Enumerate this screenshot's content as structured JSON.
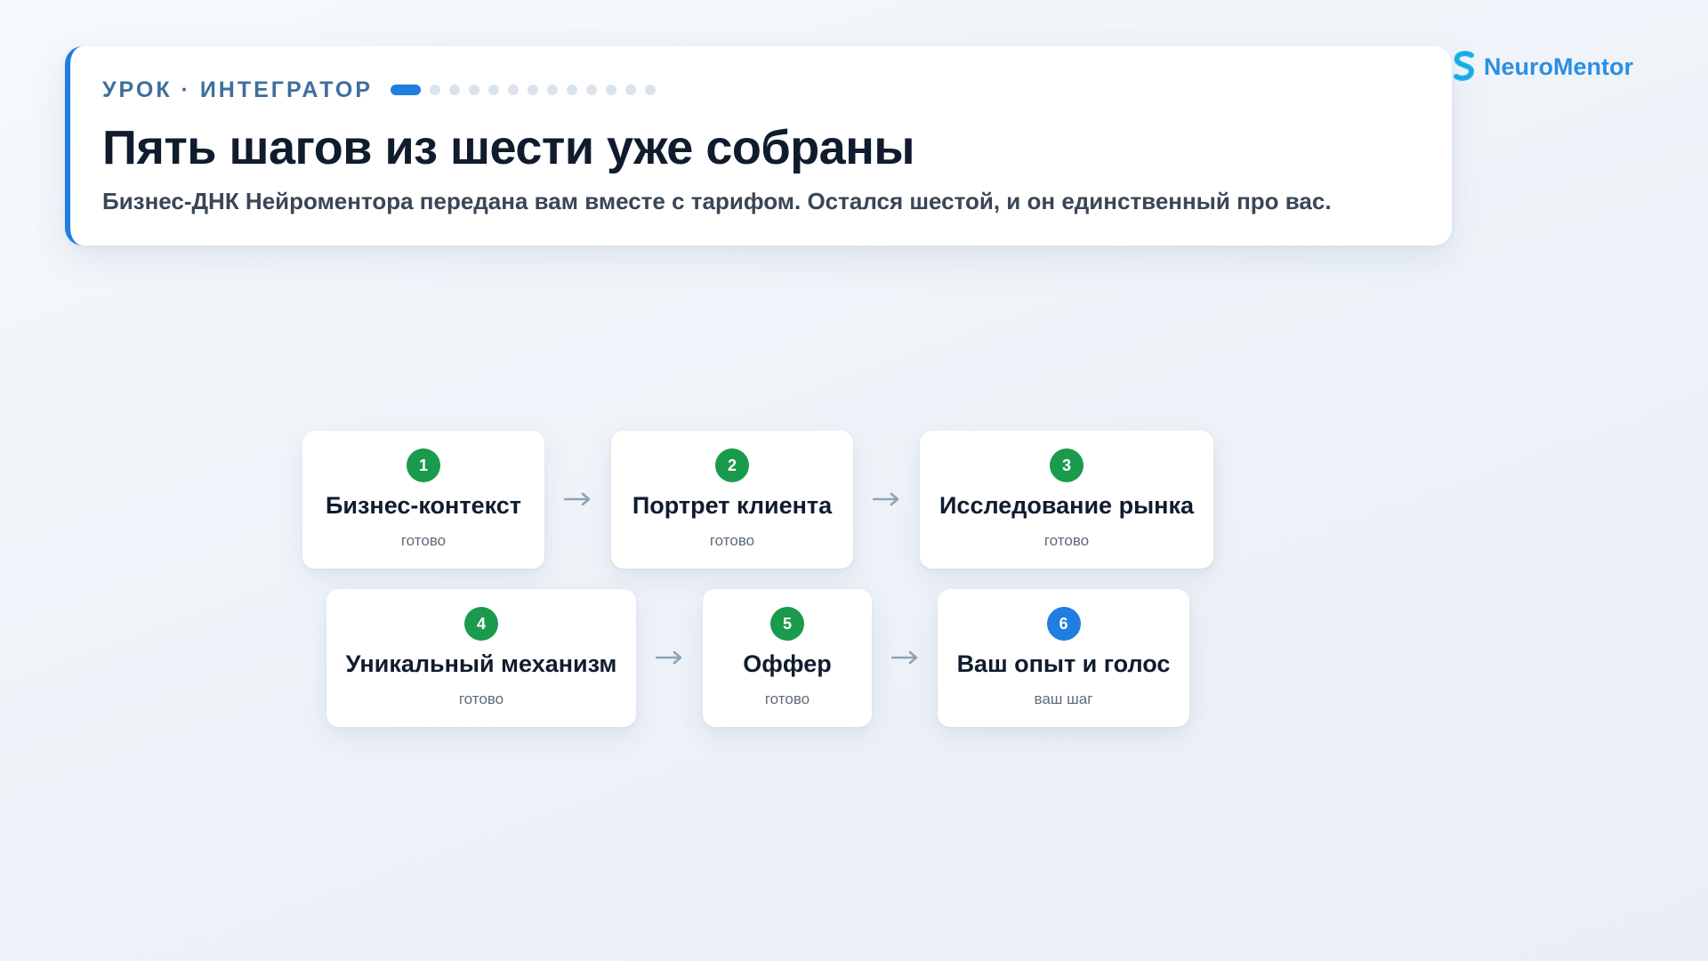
{
  "header": {
    "eyebrow": "УРОК · ИНТЕГРАТОР",
    "progress": {
      "current": 1,
      "total": 13
    },
    "title": "Пять шагов из шести уже собраны",
    "subtitle": "Бизнес-ДНК Нейроментора передана вам вместе с тарифом. Остался шестой, и он единственный про вас."
  },
  "logo": {
    "text": "NeuroMentor",
    "icon": "neuromentor-logo-icon"
  },
  "colors": {
    "accent": "#1f7ee0",
    "done": "#1a9a4c",
    "current": "#1f7ee0",
    "logo": "#2b8fe2"
  },
  "steps": [
    {
      "number": "1",
      "title": "Бизнес-контекст",
      "status": "готово",
      "state": "done"
    },
    {
      "number": "2",
      "title": "Портрет клиента",
      "status": "готово",
      "state": "done"
    },
    {
      "number": "3",
      "title": "Исследование рынка",
      "status": "готово",
      "state": "done"
    },
    {
      "number": "4",
      "title": "Уникальный механизм",
      "status": "готово",
      "state": "done"
    },
    {
      "number": "5",
      "title": "Оффер",
      "status": "готово",
      "state": "done"
    },
    {
      "number": "6",
      "title": "Ваш опыт и голос",
      "status": "ваш шаг",
      "state": "current"
    }
  ]
}
